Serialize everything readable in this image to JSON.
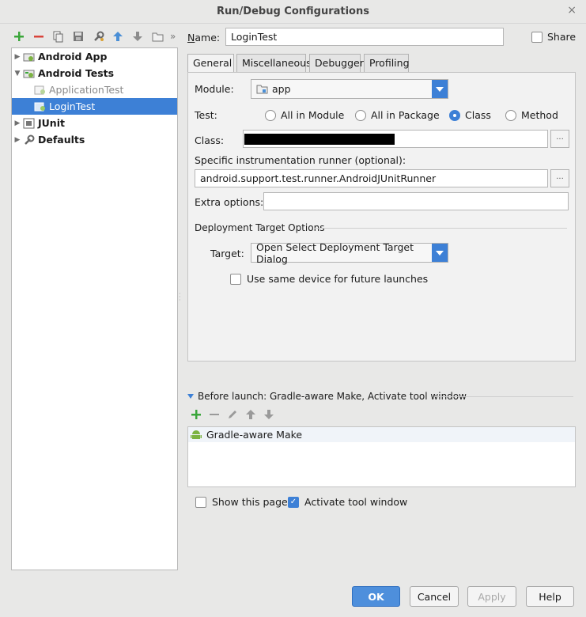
{
  "window": {
    "title": "Run/Debug Configurations",
    "close_symbol": "×"
  },
  "toolbar": {
    "overflow": "»"
  },
  "tree": {
    "items": [
      {
        "label": "Android App",
        "expanded": false
      },
      {
        "label": "Android Tests",
        "expanded": true
      },
      {
        "label": "ApplicationTest"
      },
      {
        "label": "LoginTest",
        "selected": true
      },
      {
        "label": "JUnit",
        "expanded": false
      },
      {
        "label": "Defaults",
        "expanded": false
      }
    ]
  },
  "name_field": {
    "label": "Name:",
    "value": "LoginTest"
  },
  "share": {
    "label": "Share",
    "checked": false
  },
  "tabs": [
    "General",
    "Miscellaneous",
    "Debugger",
    "Profiling"
  ],
  "general": {
    "module_label": "Module:",
    "module_value": "app",
    "test_label": "Test:",
    "test_options": [
      "All in Module",
      "All in Package",
      "Class",
      "Method"
    ],
    "test_selected": "Class",
    "class_label": "Class:",
    "runner_label": "Specific instrumentation runner (optional):",
    "runner_value": "android.support.test.runner.AndroidJUnitRunner",
    "extra_label": "Extra options:",
    "extra_value": "",
    "browse_symbol": "...",
    "deployment_header": "Deployment Target Options",
    "target_label": "Target:",
    "target_value": "Open Select Deployment Target Dialog",
    "same_device_label": "Use same device for future launches",
    "same_device_checked": false
  },
  "before_launch": {
    "header": "Before launch: Gradle-aware Make, Activate tool window",
    "items": [
      "Gradle-aware Make"
    ]
  },
  "show_page": {
    "label": "Show this page",
    "checked": false
  },
  "activate_tool": {
    "label": "Activate tool window",
    "checked": true
  },
  "buttons": {
    "ok": "OK",
    "cancel": "Cancel",
    "apply": "Apply",
    "help": "Help"
  },
  "colors": {
    "accent": "#3d80d6",
    "add_green": "#3aa63a",
    "remove_red": "#d9443b",
    "android_green": "#7cb342"
  }
}
